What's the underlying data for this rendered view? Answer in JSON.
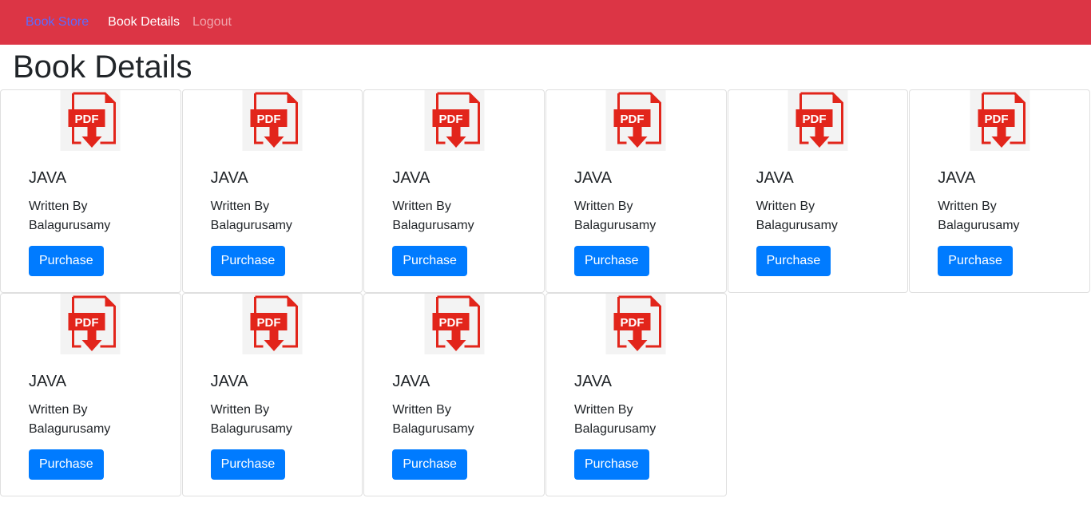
{
  "navbar": {
    "brand": "Book Store",
    "links": [
      "Book Details",
      "Logout"
    ]
  },
  "page": {
    "title": "Book Details"
  },
  "pdf_icon_text": "PDF",
  "books": [
    {
      "title": "JAVA",
      "author_line1": "Written By",
      "author_line2": "Balagurusamy",
      "button": "Purchase"
    },
    {
      "title": "JAVA",
      "author_line1": "Written By",
      "author_line2": "Balagurusamy",
      "button": "Purchase"
    },
    {
      "title": "JAVA",
      "author_line1": "Written By",
      "author_line2": "Balagurusamy",
      "button": "Purchase"
    },
    {
      "title": "JAVA",
      "author_line1": "Written By",
      "author_line2": "Balagurusamy",
      "button": "Purchase"
    },
    {
      "title": "JAVA",
      "author_line1": "Written By",
      "author_line2": "Balagurusamy",
      "button": "Purchase"
    },
    {
      "title": "JAVA",
      "author_line1": "Written By",
      "author_line2": "Balagurusamy",
      "button": "Purchase"
    },
    {
      "title": "JAVA",
      "author_line1": "Written By",
      "author_line2": "Balagurusamy",
      "button": "Purchase"
    },
    {
      "title": "JAVA",
      "author_line1": "Written By",
      "author_line2": "Balagurusamy",
      "button": "Purchase"
    },
    {
      "title": "JAVA",
      "author_line1": "Written By",
      "author_line2": "Balagurusamy",
      "button": "Purchase"
    },
    {
      "title": "JAVA",
      "author_line1": "Written By",
      "author_line2": "Balagurusamy",
      "button": "Purchase"
    }
  ],
  "colors": {
    "navbar": "#dc3545",
    "brand": "#5b6bff",
    "button": "#007bff",
    "pdf_red": "#e2251b"
  }
}
